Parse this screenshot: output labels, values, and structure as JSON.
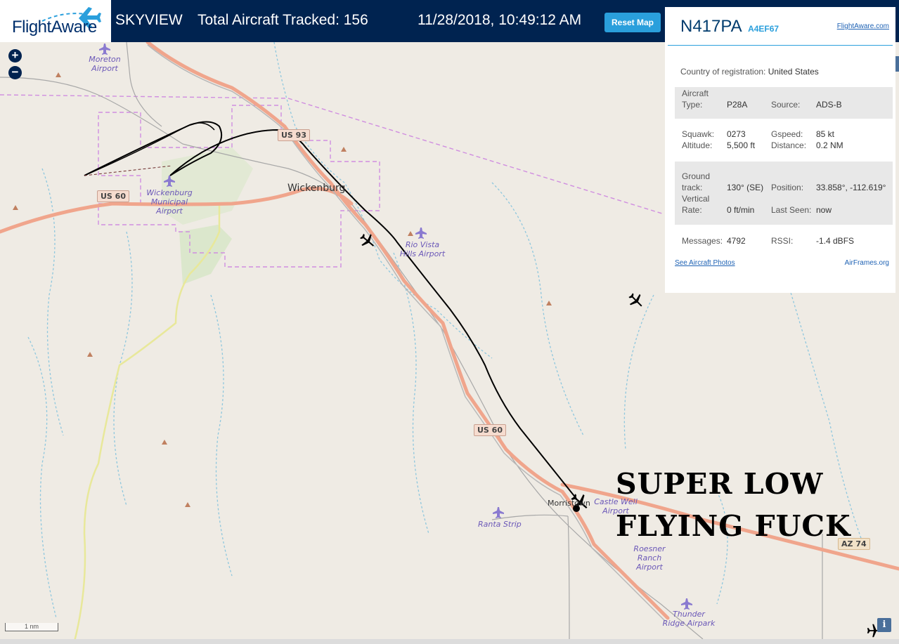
{
  "header": {
    "logo_text": "FlightAware",
    "view_label": "SKYVIEW",
    "total_tracked": "Total Aircraft Tracked: 156",
    "datetime": "11/28/2018, 10:49:12 AM",
    "reset_label": "Reset Map"
  },
  "map": {
    "zoom_in": "+",
    "zoom_out": "−",
    "towns": [
      "Wickenburg",
      "Morristown"
    ],
    "airports": [
      "Moreton Airport",
      "Wickenburg Municipal Airport",
      "Rio Vista Hills Airport",
      "Castle Well Airport",
      "Ranta Strip",
      "Roesner Ranch Airport",
      "Thunder Ridge Airpark"
    ],
    "routes": [
      "US 93",
      "US 60",
      "US 60",
      "AZ 74"
    ],
    "scale_label": "1 nm",
    "info_label": "i"
  },
  "overlay_caption": {
    "line1": "SUPER LOW",
    "line2": "FLYING FUCK"
  },
  "aircraft_panel": {
    "registration": "N417PA",
    "hex": "A4EF67",
    "flightaware_link": "FlightAware.com",
    "country_label": "Country of registration:",
    "country_value": "United States",
    "aircraft_type_label": "Aircraft Type:",
    "aircraft_type_value": "P28A",
    "source_label": "Source:",
    "source_value": "ADS-B",
    "squawk_label": "Squawk:",
    "squawk_value": "0273",
    "gspeed_label": "Gspeed:",
    "gspeed_value": "85 kt",
    "altitude_label": "Altitude:",
    "altitude_value": "5,500 ft",
    "distance_label": "Distance:",
    "distance_value": "0.2 NM",
    "ground_track_label": "Ground track:",
    "ground_track_value": "130° (SE)",
    "position_label": "Position:",
    "position_value": "33.858°, -112.619°",
    "vertical_rate_label": "Vertical Rate:",
    "vertical_rate_value": "0 ft/min",
    "last_seen_label": "Last Seen:",
    "last_seen_value": "now",
    "messages_label": "Messages:",
    "messages_value": "4792",
    "rssi_label": "RSSI:",
    "rssi_value": "-1.4 dBFS",
    "photos_link": "See Aircraft Photos",
    "airframes_link": "AirFrames.org"
  },
  "colors": {
    "header_bg": "#002350",
    "accent": "#2a9fdc",
    "map_bg": "#efebe4",
    "highway": "#f0a58c",
    "airport_label": "#6b58b8",
    "track": "#000000"
  }
}
